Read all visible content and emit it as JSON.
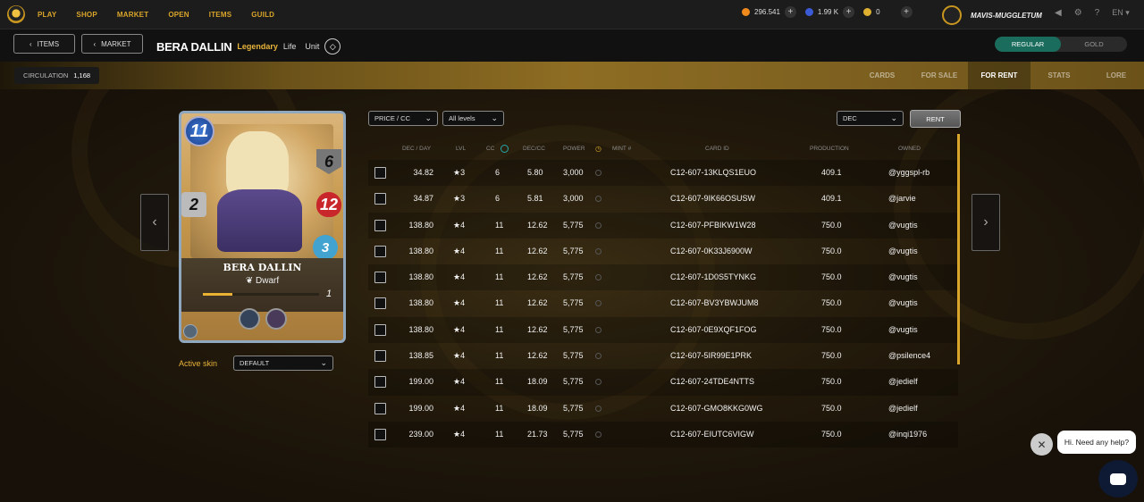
{
  "topnav": {
    "items": [
      "PLAY",
      "SHOP",
      "MARKET",
      "OPEN",
      "ITEMS",
      "GUILD"
    ],
    "balances": [
      {
        "value": "296.541",
        "color": "#f08a1c"
      },
      {
        "value": "1.99 K",
        "color": "#3b5bd6"
      },
      {
        "value": "0",
        "color": "#e0b030"
      }
    ],
    "username": "MAVIS-MUGGLETUM",
    "lang": "EN"
  },
  "subbar": {
    "items_btn": "ITEMS",
    "market_btn": "MARKET",
    "card_name": "BERA DALLIN",
    "rarity": "Legendary",
    "element": "Life",
    "type": "Unit",
    "toggle_regular": "REGULAR",
    "toggle_gold": "GOLD"
  },
  "goldbar": {
    "circulation_label": "CIRCULATION",
    "circulation_value": "1,168",
    "tabs": [
      "CARDS",
      "FOR SALE",
      "FOR RENT",
      "STATS",
      "LORE"
    ],
    "active_tab": "FOR RENT"
  },
  "card": {
    "mana": "11",
    "attack": "6",
    "health": "12",
    "speed": "3",
    "melee": "2",
    "name": "BERA DALLIN",
    "race": "Dwarf",
    "level": "1",
    "level_progress": 0.25
  },
  "skin": {
    "label": "Active skin",
    "value": "DEFAULT"
  },
  "filters": {
    "sort": "PRICE / CC",
    "levels": "All levels",
    "currency": "DEC",
    "rent_btn": "RENT"
  },
  "table": {
    "headers": [
      "DEC / DAY",
      "LVL",
      "CC",
      "DEC/CC",
      "POWER",
      "MINT #",
      "CARD ID",
      "PRODUCTION",
      "OWNED"
    ],
    "rows": [
      {
        "dec_day": "34.82",
        "lvl": "★3",
        "cc": "6",
        "dec_cc": "5.80",
        "power": "3,000",
        "card_id": "C12-607-13KLQS1EUO",
        "production": "409.1",
        "owner": "@yggspl-rb"
      },
      {
        "dec_day": "34.87",
        "lvl": "★3",
        "cc": "6",
        "dec_cc": "5.81",
        "power": "3,000",
        "card_id": "C12-607-9IK66OSUSW",
        "production": "409.1",
        "owner": "@jarvie"
      },
      {
        "dec_day": "138.80",
        "lvl": "★4",
        "cc": "11",
        "dec_cc": "12.62",
        "power": "5,775",
        "card_id": "C12-607-PFBIKW1W28",
        "production": "750.0",
        "owner": "@vugtis"
      },
      {
        "dec_day": "138.80",
        "lvl": "★4",
        "cc": "11",
        "dec_cc": "12.62",
        "power": "5,775",
        "card_id": "C12-607-0K33J6900W",
        "production": "750.0",
        "owner": "@vugtis"
      },
      {
        "dec_day": "138.80",
        "lvl": "★4",
        "cc": "11",
        "dec_cc": "12.62",
        "power": "5,775",
        "card_id": "C12-607-1D0S5TYNKG",
        "production": "750.0",
        "owner": "@vugtis"
      },
      {
        "dec_day": "138.80",
        "lvl": "★4",
        "cc": "11",
        "dec_cc": "12.62",
        "power": "5,775",
        "card_id": "C12-607-BV3YBWJUM8",
        "production": "750.0",
        "owner": "@vugtis"
      },
      {
        "dec_day": "138.80",
        "lvl": "★4",
        "cc": "11",
        "dec_cc": "12.62",
        "power": "5,775",
        "card_id": "C12-607-0E9XQF1FOG",
        "production": "750.0",
        "owner": "@vugtis"
      },
      {
        "dec_day": "138.85",
        "lvl": "★4",
        "cc": "11",
        "dec_cc": "12.62",
        "power": "5,775",
        "card_id": "C12-607-5IR99E1PRK",
        "production": "750.0",
        "owner": "@psilence4"
      },
      {
        "dec_day": "199.00",
        "lvl": "★4",
        "cc": "11",
        "dec_cc": "18.09",
        "power": "5,775",
        "card_id": "C12-607-24TDE4NTTS",
        "production": "750.0",
        "owner": "@jedielf"
      },
      {
        "dec_day": "199.00",
        "lvl": "★4",
        "cc": "11",
        "dec_cc": "18.09",
        "power": "5,775",
        "card_id": "C12-607-GMO8KKG0WG",
        "production": "750.0",
        "owner": "@jedielf"
      },
      {
        "dec_day": "239.00",
        "lvl": "★4",
        "cc": "11",
        "dec_cc": "21.73",
        "power": "5,775",
        "card_id": "C12-607-EIUTC6VIGW",
        "production": "750.0",
        "owner": "@inqi1976"
      }
    ]
  },
  "chat": {
    "bubble": "Hi. Need any help?"
  }
}
